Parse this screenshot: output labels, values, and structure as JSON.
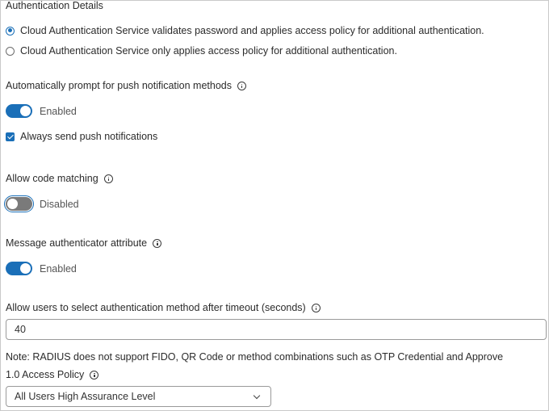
{
  "auth_details": {
    "heading": "Authentication Details",
    "options": [
      {
        "label": "Cloud Authentication Service validates password and applies access policy for additional authentication.",
        "selected": true
      },
      {
        "label": "Cloud Authentication Service only applies access policy for additional authentication.",
        "selected": false
      }
    ]
  },
  "push_prompt": {
    "label": "Automatically prompt for push notification methods",
    "toggle_state": "Enabled",
    "checkbox_label": "Always send push notifications",
    "checkbox_checked": true
  },
  "code_matching": {
    "label": "Allow code matching",
    "toggle_state": "Disabled"
  },
  "message_auth": {
    "label": "Message authenticator attribute",
    "toggle_state": "Enabled"
  },
  "timeout": {
    "label": "Allow users to select authentication method after timeout (seconds)",
    "value": "40"
  },
  "note": "Note: RADIUS does not support FIDO, QR Code or method combinations such as OTP Credential and Approve",
  "access_policy": {
    "label": "1.0 Access Policy",
    "selected": "All Users High Assurance Level"
  },
  "colors": {
    "accent": "#1a6fb8",
    "toggle_off": "#7a7a7a"
  }
}
